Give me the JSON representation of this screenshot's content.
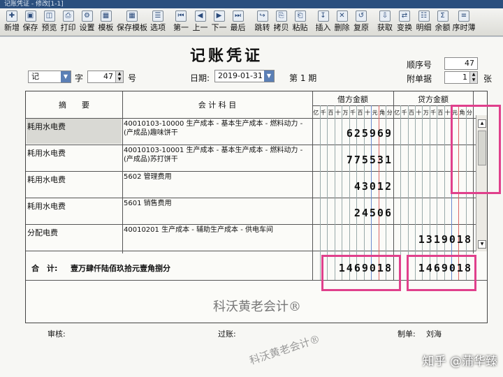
{
  "window": {
    "title": "记账凭证 - 修改[1-1]"
  },
  "toolbar": {
    "buttons": [
      {
        "label": "新增"
      },
      {
        "label": "保存"
      },
      {
        "label": "预览"
      },
      {
        "label": "打印"
      },
      {
        "label": "设置"
      },
      {
        "label": "模板"
      },
      {
        "label": "保存模板"
      },
      {
        "label": "选项"
      },
      {
        "label": "第一"
      },
      {
        "label": "上一"
      },
      {
        "label": "下一"
      },
      {
        "label": "最后"
      },
      {
        "label": "跳转"
      },
      {
        "label": "拷贝"
      },
      {
        "label": "粘贴"
      },
      {
        "label": "插入"
      },
      {
        "label": "删除"
      },
      {
        "label": "复原"
      },
      {
        "label": "获取"
      },
      {
        "label": "变换"
      },
      {
        "label": "明细"
      },
      {
        "label": "余额"
      },
      {
        "label": "序时薄"
      }
    ]
  },
  "voucher": {
    "title": "记账凭证",
    "word_type": "记",
    "word_label": "字",
    "number": "47",
    "number_label": "号",
    "date_label": "日期:",
    "date": "2019-01-31",
    "period": "第 1 期",
    "seq_label": "顺序号",
    "seq": "47",
    "attach_label": "附单据",
    "attach": "1",
    "attach_unit": "张"
  },
  "table": {
    "headers": {
      "summary": "摘　　要",
      "account": "会 计 科 目",
      "debit": "借方金额",
      "credit": "贷方金额"
    },
    "digit_units": [
      "亿",
      "千",
      "百",
      "十",
      "万",
      "千",
      "百",
      "十",
      "元",
      "角",
      "分"
    ],
    "rows": [
      {
        "summary": "耗用水电费",
        "account": "40010103-10000 生产成本 - 基本生产成本 - 燃料动力 - (产成品)趣味饼干",
        "debit": "625969",
        "credit": ""
      },
      {
        "summary": "耗用水电费",
        "account": "40010103-10001 生产成本 - 基本生产成本 - 燃料动力 - (产成品)苏打饼干",
        "debit": "775531",
        "credit": ""
      },
      {
        "summary": "耗用水电费",
        "account": "5602 管理费用",
        "debit": "43012",
        "credit": ""
      },
      {
        "summary": "耗用水电费",
        "account": "5601 销售费用",
        "debit": "24506",
        "credit": ""
      },
      {
        "summary": "分配电费",
        "account": "40010201 生产成本 - 辅助生产成本 - 供电车间",
        "debit": "",
        "credit": "1319018"
      }
    ],
    "total_label": "合　计:",
    "total_words": "壹万肆仟陆佰玖拾元壹角捌分",
    "total_debit": "1469018",
    "total_credit": "1469018"
  },
  "watermark": "科沃黄老会计®",
  "watermark2": "科沃黄老会计®",
  "footer": {
    "review_label": "审核:",
    "post_label": "过账:",
    "maker_label": "制单:",
    "maker": "刘海"
  },
  "overlay": {
    "brand": "知乎 @蒲华臻"
  },
  "colors": {
    "highlight": "#e0408c",
    "accent": "#2b4f7e"
  }
}
